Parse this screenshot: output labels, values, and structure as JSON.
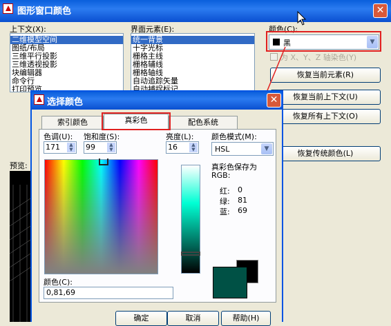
{
  "main": {
    "title": "图形窗口颜色",
    "context_label": "上下文(X):",
    "context_items": [
      "二维模型空间",
      "图纸/布局",
      "三维平行投影",
      "三维透视投影",
      "块编辑器",
      "命令行",
      "打印预览"
    ],
    "element_label": "界面元素(E):",
    "element_items": [
      "统一背景",
      "十字光标",
      "栅格主线",
      "栅格辅线",
      "栅格轴线",
      "自动追踪矢量",
      "自动捕捉标记"
    ],
    "color_label": "颜色(C):",
    "color_value": "黑",
    "tint_label": "为 X、Y、Z 轴染色(Y)",
    "btn_restore_element": "恢复当前元素(R)",
    "btn_restore_context": "恢复当前上下文(U)",
    "btn_restore_all": "恢复所有上下文(O)",
    "btn_restore_classic": "恢复传统颜色(L)",
    "preview_label": "预览:"
  },
  "dlg": {
    "title": "选择颜色",
    "tabs": [
      "索引颜色",
      "真彩色",
      "配色系统"
    ],
    "hue_label": "色调(U):",
    "hue_value": "171",
    "sat_label": "饱和度(S):",
    "sat_value": "99",
    "lum_label": "亮度(L):",
    "lum_value": "16",
    "model_label": "颜色模式(M):",
    "model_value": "HSL",
    "save_label": "真彩色保存为",
    "rgb_label": "RGB:",
    "r_label": "红:",
    "r_value": "0",
    "g_label": "绿:",
    "g_value": "81",
    "b_label": "蓝:",
    "b_value": "69",
    "color_label": "颜色(C):",
    "color_value": "0,81,69",
    "ok": "确定",
    "cancel": "取消",
    "help": "帮助(H)"
  },
  "colors": {
    "selected": "#005145",
    "accent": "#e02020"
  }
}
